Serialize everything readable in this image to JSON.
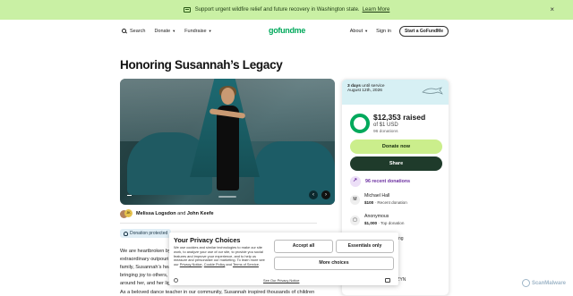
{
  "banner": {
    "text": "Support urgent wildfire relief and future recovery in Washington state.",
    "link": "Learn More",
    "close": "×"
  },
  "nav": {
    "search": "Search",
    "donate": "Donate",
    "fundraise": "Fundraise",
    "logo": "gofundme",
    "about": "About",
    "signin": "Sign in",
    "start": "Start a GoFundMe"
  },
  "campaign": {
    "title": "Honoring Susannah’s Legacy",
    "organizer1": "Melissa Logsdon",
    "and": "and",
    "organizer2": "John Keefe",
    "avatar_badge": "JK",
    "protected_badge": "Donation protected",
    "story_line1": "We are heartbroken by",
    "story_line2": "extraordinary outpouri",
    "story_line3": "family, Susannah’s heart",
    "story_line4": "bringing joy to others,",
    "story_line5": "around her, and her lig",
    "story_next": "As a beloved dance teacher in our community, Susannah inspired thousands of children"
  },
  "panel": {
    "days": "3 days",
    "days_suffix": " until service",
    "date": "August 12th, 2026",
    "raised": "$12,353 raised",
    "goal": "of $1 USD",
    "donations": "96 donations",
    "donate_btn": "Donate now",
    "share_btn": "Share",
    "recent": "96 recent donations",
    "donor1_initial": "M",
    "donor1_name": "Michael Hall",
    "donor1_amount": "$100",
    "donor1_tag": " · Recent donation",
    "donor2_name": "Anonymous",
    "donor2_amount": "$1,000",
    "donor2_tag": " · Top donation",
    "tail1": "ng",
    "tail2": "a KOZYN"
  },
  "cookie": {
    "title": "Your Privacy Choices",
    "body1": "We use cookies and similar technologies to make our site work, to analyze your use of our site, to provide you social features and improve your experience, and to help us measure and personalize our marketing. To learn more see our ",
    "privacy_link": "Privacy Notice",
    "comma": ", ",
    "cookie_link": "Cookie Policy",
    "and": " and ",
    "terms_link": "Terms of Service",
    "period": ".",
    "policy": "See Our Privacy Notice",
    "accept": "Accept all",
    "essential": "Essentials only",
    "more": "More choices"
  },
  "watermark": "ScanMalware",
  "colors": {
    "brand_green": "#02a95c",
    "banner_bg": "#c9f0a4",
    "donate_bg": "#cbee8c",
    "share_bg": "#1f3b2b",
    "recent_purple": "#6b2fa0"
  },
  "progress": {
    "ring_fill_fraction": 1.0
  }
}
